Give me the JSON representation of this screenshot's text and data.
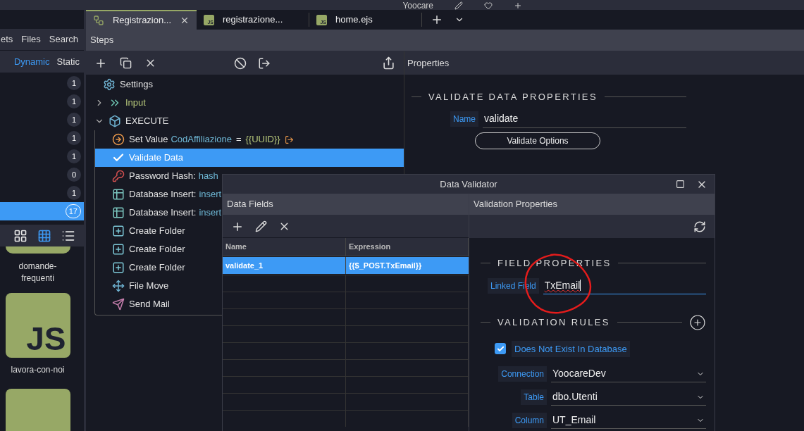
{
  "app_title": "Yoocare",
  "editor_tabs": [
    {
      "label": "Registrazion...",
      "kind": "flow",
      "selected": true
    },
    {
      "label": "registrazione...",
      "kind": "file",
      "icon_text": "JS",
      "selected": false
    },
    {
      "label": "home.ejs",
      "kind": "file",
      "icon_text": "JS",
      "selected": false
    }
  ],
  "sidebar": {
    "tabs": [
      {
        "label": "ets",
        "selected": false
      },
      {
        "label": "Files",
        "selected": false
      },
      {
        "label": "Search",
        "selected": false
      }
    ],
    "filters": [
      {
        "label": "Dynamic",
        "selected": true
      },
      {
        "label": "Static",
        "selected": false
      }
    ],
    "counts": [
      {
        "count": "1",
        "selected": false
      },
      {
        "count": "1",
        "selected": false
      },
      {
        "count": "1",
        "selected": false
      },
      {
        "count": "1",
        "selected": false
      },
      {
        "count": "1",
        "selected": false
      },
      {
        "count": "0",
        "selected": false
      },
      {
        "count": "1",
        "selected": false
      },
      {
        "count": "17",
        "selected": true
      }
    ],
    "views": [
      {
        "kind": "large-grid",
        "selected": false
      },
      {
        "kind": "small-grid",
        "selected": true
      },
      {
        "kind": "list",
        "selected": false
      }
    ],
    "tiles": [
      {
        "kind": "cut-top",
        "label": "domande-frequenti"
      },
      {
        "kind": "js",
        "badge": "JS",
        "label": "lavora-con-noi"
      },
      {
        "kind": "cut-bottom"
      }
    ]
  },
  "steps": {
    "title": "Steps",
    "items": [
      {
        "kind": "settings",
        "label": "Settings",
        "selected": false
      },
      {
        "kind": "input",
        "label": "Input",
        "expanded": false,
        "selected": false
      },
      {
        "kind": "execute",
        "label": "EXECUTE",
        "expanded": true,
        "selected": false,
        "children": [
          {
            "kind": "setvalue",
            "label": "Set Value",
            "name": "CodAffiliazione",
            "op": "=",
            "value": "{{UUID}}",
            "selected": false
          },
          {
            "kind": "check",
            "label": "Validate Data",
            "selected": true
          },
          {
            "kind": "key",
            "label": "Password Hash:",
            "name": "hash",
            "selected": false
          },
          {
            "kind": "table",
            "label": "Database Insert:",
            "name": "insert",
            "selected": false
          },
          {
            "kind": "table",
            "label": "Database Insert:",
            "name": "insert",
            "selected": false
          },
          {
            "kind": "folder",
            "label": "Create Folder",
            "selected": false
          },
          {
            "kind": "folder",
            "label": "Create Folder",
            "selected": false
          },
          {
            "kind": "folder",
            "label": "Create Folder",
            "selected": false
          },
          {
            "kind": "move",
            "label": "File Move",
            "selected": false
          },
          {
            "kind": "mail",
            "label": "Send Mail",
            "selected": false
          }
        ]
      }
    ]
  },
  "properties": {
    "title": "Properties",
    "section": "VALIDATE DATA PROPERTIES",
    "name_label": "Name",
    "name_value": "validate",
    "options_button": "Validate Options"
  },
  "dialog": {
    "title": "Data Validator",
    "fields_panel": {
      "title": "Data Fields",
      "columns": [
        "Name",
        "Expression"
      ],
      "rows": [
        {
          "name": "validate_1",
          "expression": "{{$_POST.TxEmail}}",
          "selected": true
        }
      ]
    },
    "props_panel": {
      "title": "Validation Properties",
      "field_section": "FIELD PROPERTIES",
      "linked_label": "Linked Field",
      "linked_value": "TxEmail",
      "rules_section": "VALIDATION RULES",
      "rule": {
        "label": "Does Not Exist In Database",
        "checked": true
      },
      "selects": [
        {
          "label": "Connection",
          "value": "YoocareDev"
        },
        {
          "label": "Table",
          "value": "dbo.Utenti"
        },
        {
          "label": "Column",
          "value": "UT_Email"
        }
      ]
    }
  }
}
